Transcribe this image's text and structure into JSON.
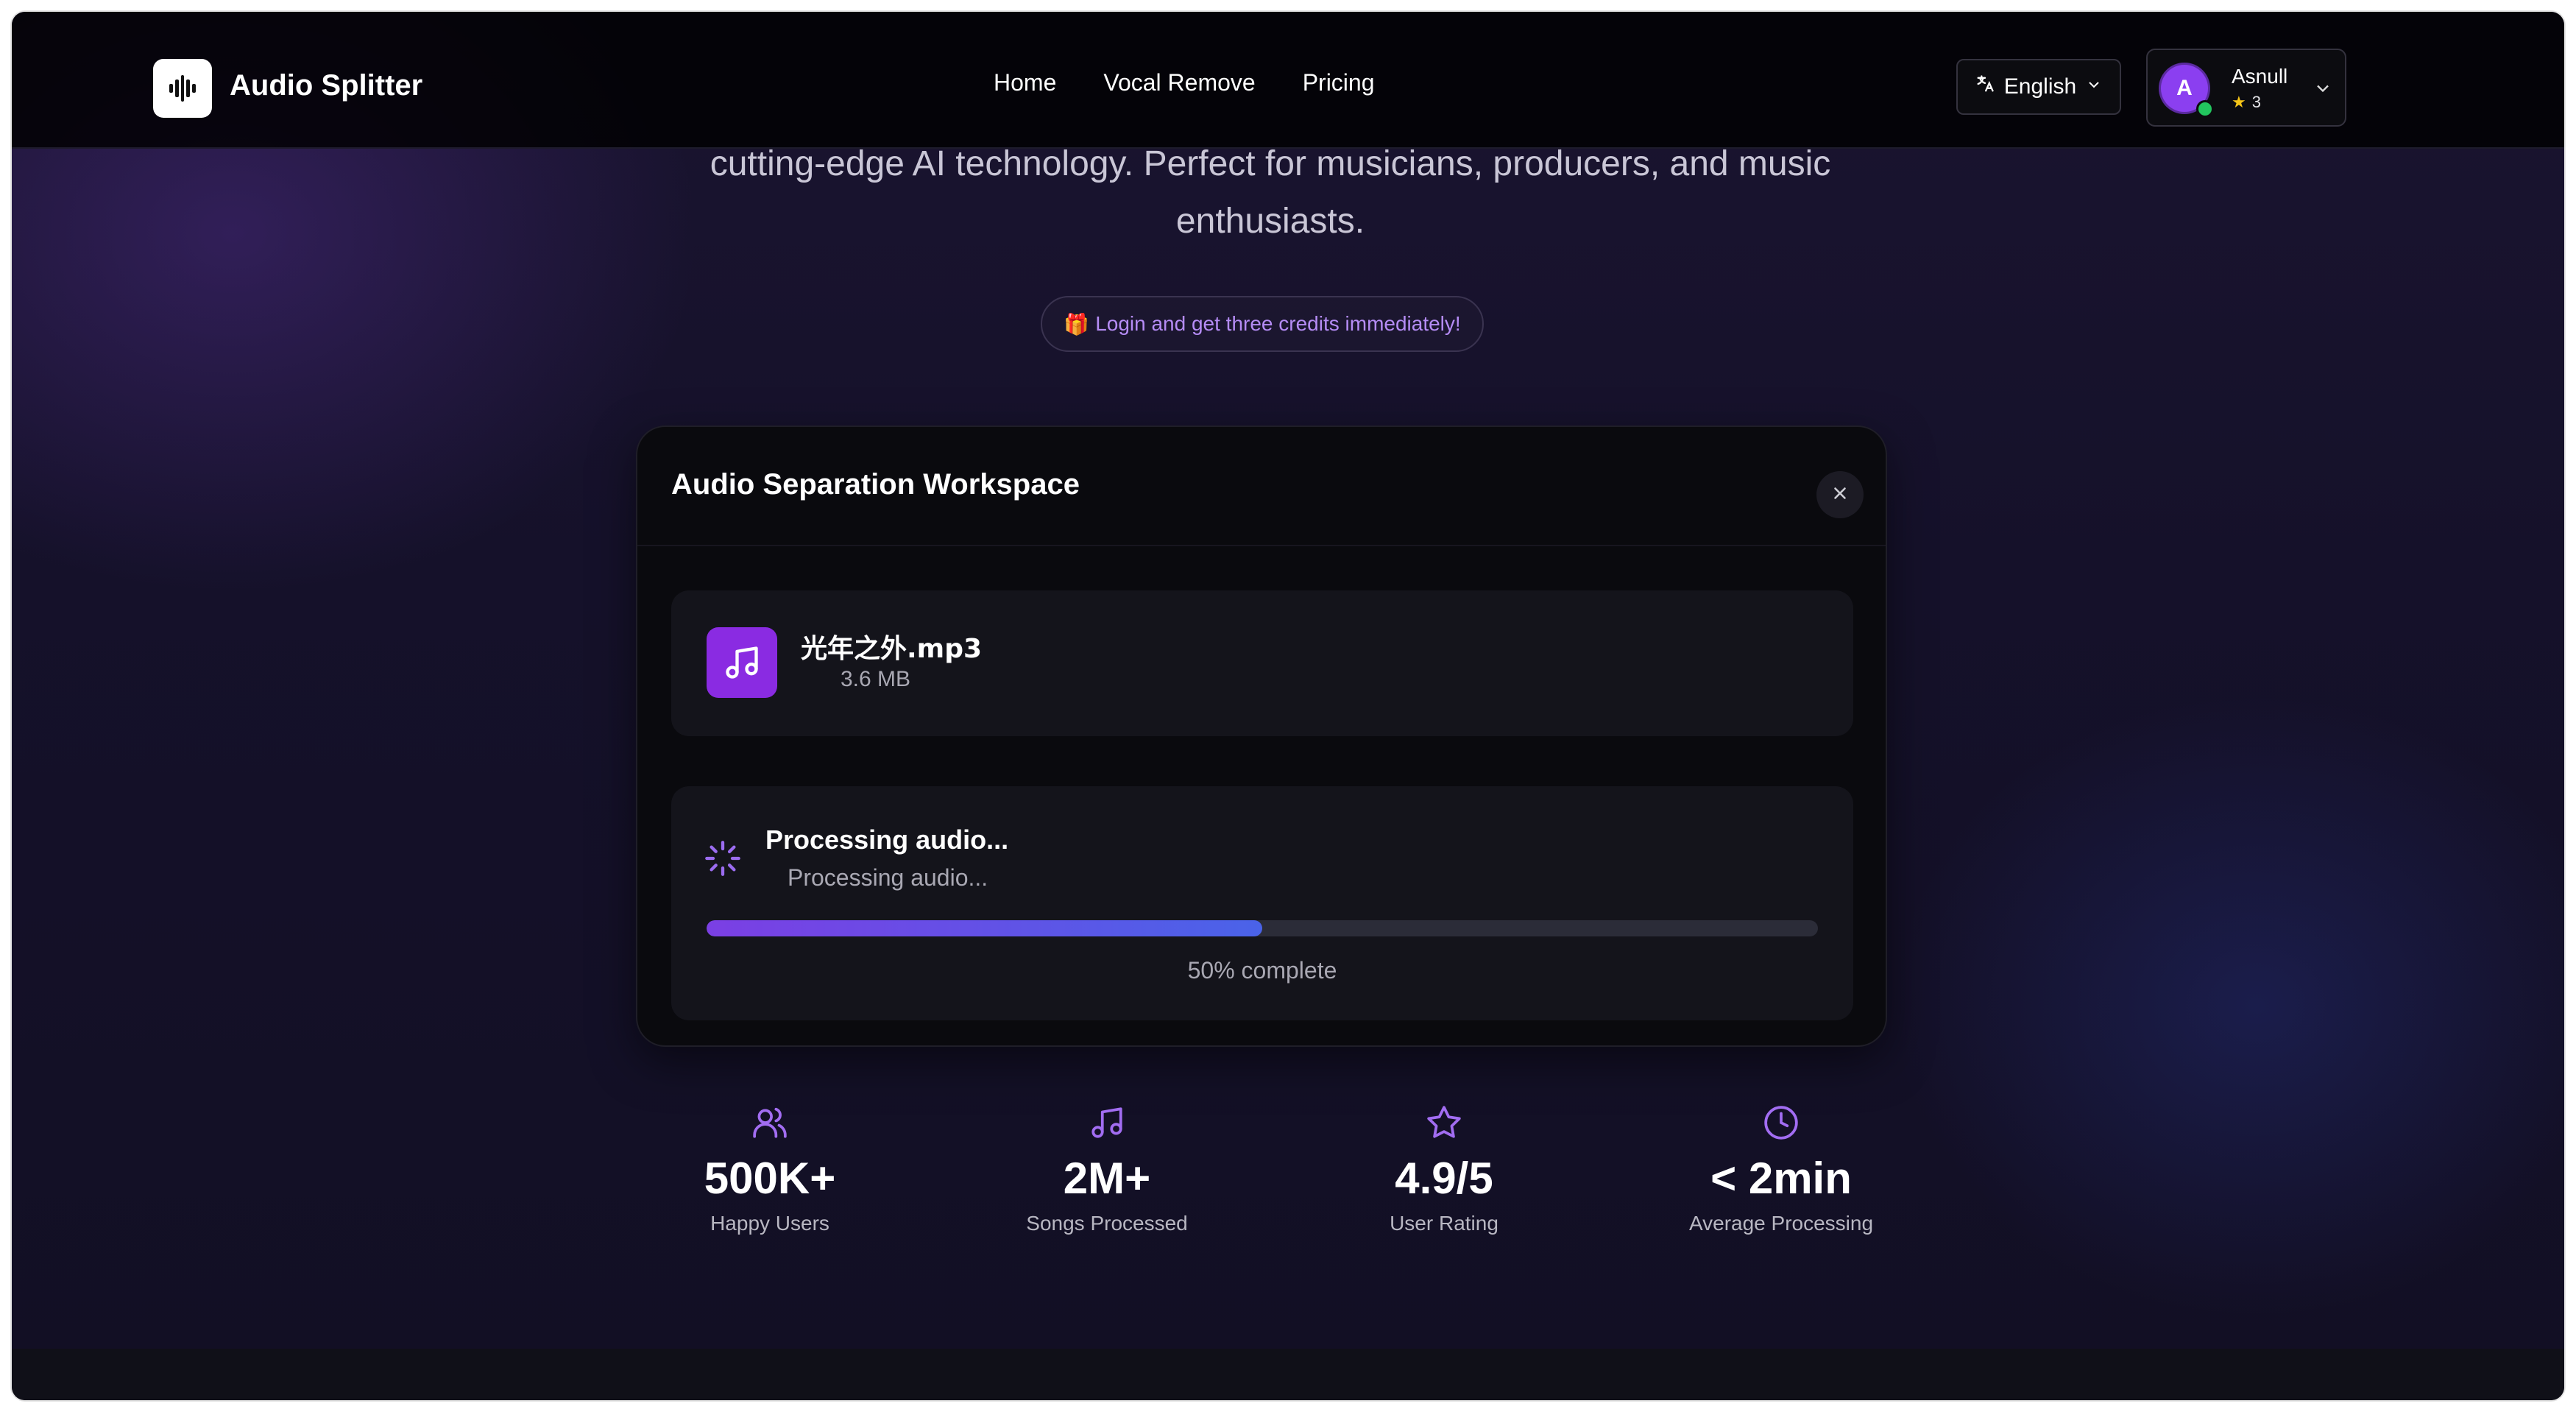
{
  "header": {
    "brand": "Audio Splitter",
    "nav": [
      {
        "label": "Home"
      },
      {
        "label": "Vocal Remove"
      },
      {
        "label": "Pricing"
      }
    ],
    "language": "English",
    "user": {
      "initial": "A",
      "name": "Asnull",
      "credits": "3"
    }
  },
  "hero": {
    "description": "cutting-edge AI technology. Perfect for musicians, producers, and music enthusiasts.",
    "promo": "Login and get three credits immediately!",
    "promo_icon": "gift-icon"
  },
  "workspace": {
    "title": "Audio Separation Workspace",
    "file": {
      "name": "光年之外.mp3",
      "size": "3.6 MB"
    },
    "processing": {
      "title": "Processing audio...",
      "subtitle": "Processing audio...",
      "progress": 0.5,
      "label": "50% complete"
    }
  },
  "stats": [
    {
      "icon": "users-icon",
      "value": "500K+",
      "label": "Happy Users"
    },
    {
      "icon": "music-note-icon",
      "value": "2M+",
      "label": "Songs Processed"
    },
    {
      "icon": "star-icon",
      "value": "4.9/5",
      "label": "User Rating"
    },
    {
      "icon": "clock-icon",
      "value": "< 2min",
      "label": "Average Processing"
    }
  ],
  "colors": {
    "accent": "#8a2be2",
    "progress_start": "#7b3fe4",
    "progress_end": "#4a63e8"
  }
}
